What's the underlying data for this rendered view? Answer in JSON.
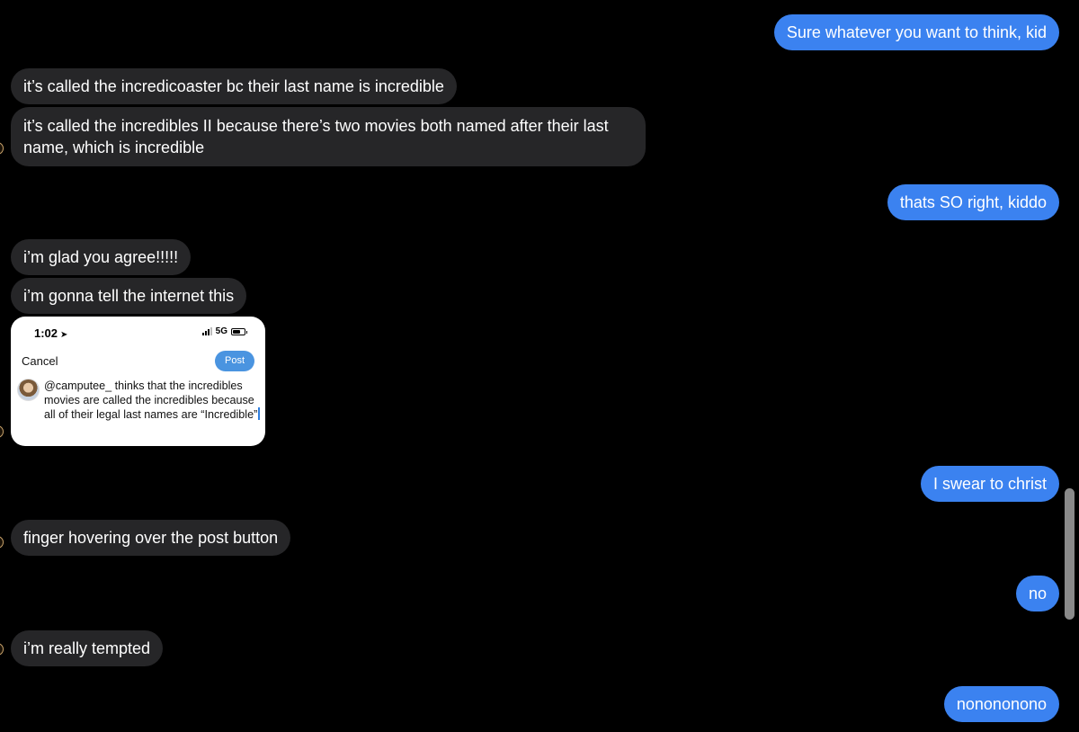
{
  "messages": [
    {
      "id": "m1",
      "dir": "out",
      "text": "Sure whatever you want to think, kid"
    },
    {
      "id": "m2",
      "dir": "in",
      "text": "it’s called the incredicoaster bc their last name is incredible"
    },
    {
      "id": "m3",
      "dir": "in",
      "text": "it’s called the incredibles II because there’s two movies both named after their last name, which is incredible"
    },
    {
      "id": "m4",
      "dir": "out",
      "text": "thats SO right, kiddo"
    },
    {
      "id": "m5",
      "dir": "in",
      "text": "i’m glad you agree!!!!!"
    },
    {
      "id": "m6",
      "dir": "in",
      "text": "i’m gonna tell the internet this"
    },
    {
      "id": "m7",
      "dir": "out",
      "text": "I swear to christ"
    },
    {
      "id": "m8",
      "dir": "in",
      "text": "finger hovering over the post button"
    },
    {
      "id": "m9",
      "dir": "out",
      "text": "no"
    },
    {
      "id": "m10",
      "dir": "in",
      "text": "i’m really tempted"
    },
    {
      "id": "m11",
      "dir": "out",
      "text": "nonononono"
    }
  ],
  "screenshot": {
    "time": "1:02",
    "network": "5G",
    "cancel_label": "Cancel",
    "post_label": "Post",
    "tweet_text": "@camputee_ thinks that the incredibles movies are called the incredibles because all of their legal last names are “Incredible”"
  },
  "icons": {
    "location": "location-arrow-icon",
    "signal": "cellular-signal-icon",
    "battery": "battery-icon"
  },
  "colors": {
    "background": "#000000",
    "incoming_bubble": "#262628",
    "outgoing_bubble": "#3b82f0",
    "post_button": "#4a94e0"
  }
}
